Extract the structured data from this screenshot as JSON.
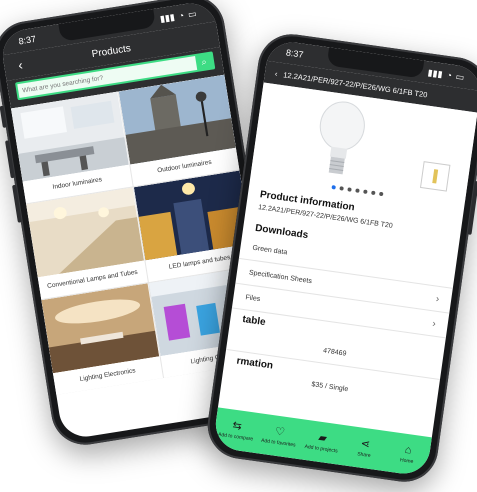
{
  "left_phone": {
    "status_time": "8:37",
    "title": "Products",
    "search": {
      "placeholder": "What are you searching for?"
    },
    "categories": [
      {
        "label": "Indoor luminaires"
      },
      {
        "label": "Outdoor luminaires"
      },
      {
        "label": "Conventional Lamps and Tubes"
      },
      {
        "label": "LED lamps and tubes"
      },
      {
        "label": "Lighting Electronics"
      },
      {
        "label": "Lighting Controls"
      }
    ]
  },
  "right_phone": {
    "status_time": "8:37",
    "title": "12.2A21/PER/927-22/P/E26/WG 6/1FB T20",
    "gallery": {
      "count": 7,
      "active_index": 0
    },
    "product_info": {
      "heading": "Product information",
      "code": "12.2A21/PER/927-22/P/E26/WG 6/1FB T20"
    },
    "downloads": {
      "heading": "Downloads",
      "items": [
        "Green data",
        "Specification Sheets",
        "Files"
      ]
    },
    "table_heading": "table",
    "table_value": "478469",
    "information_heading": "rmation",
    "partial_value": "$35 / Single",
    "tabs": [
      {
        "label": "Add to compare",
        "icon": "compare-icon"
      },
      {
        "label": "Add to favorites",
        "icon": "heart-icon"
      },
      {
        "label": "Add to projects",
        "icon": "folder-icon"
      },
      {
        "label": "Share",
        "icon": "share-icon"
      },
      {
        "label": "Home",
        "icon": "home-icon"
      }
    ]
  },
  "colors": {
    "accent": "#3ddc84",
    "bar": "#2d2e30"
  }
}
